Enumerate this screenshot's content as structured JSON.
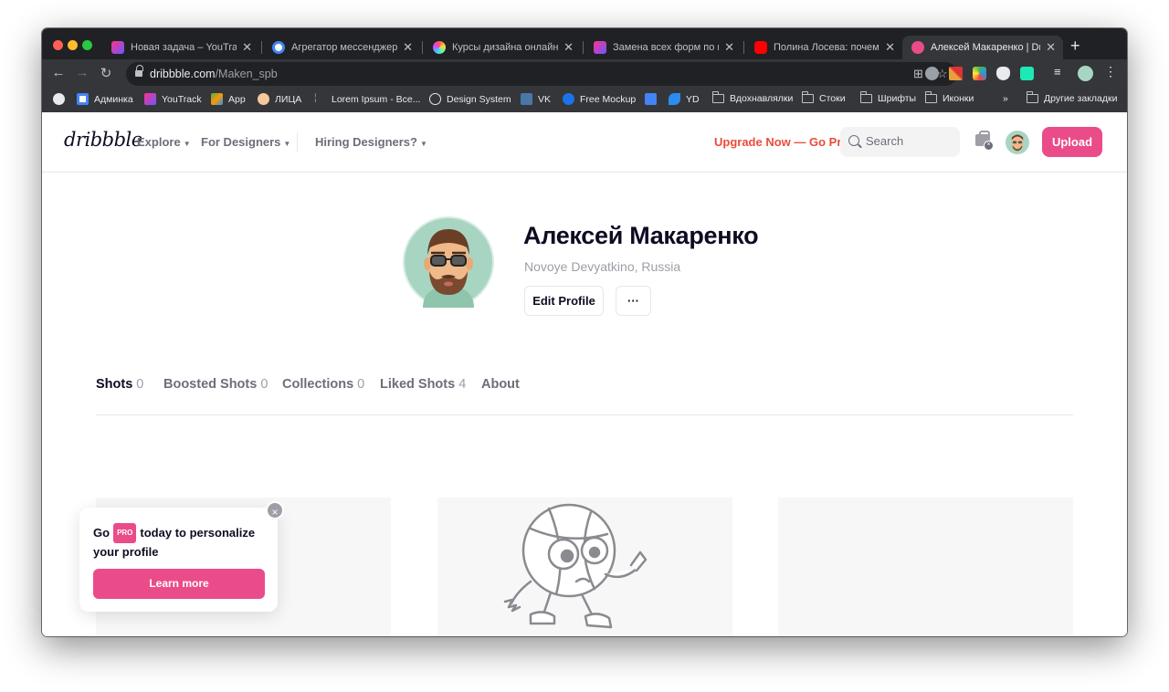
{
  "browser": {
    "tabs": [
      {
        "title": "Новая задача – YouTrack",
        "favicon_color": "#8a5cf6"
      },
      {
        "title": "Агрегатор мессенджеров",
        "favicon_color": "#4285f4"
      },
      {
        "title": "Курсы дизайна онлайн - П",
        "favicon_color": "#e040fb"
      },
      {
        "title": "Замена всех форм по нов",
        "favicon_color": "#8a5cf6"
      },
      {
        "title": "Полина Лосева: почему м",
        "favicon_color": "#ff0000"
      },
      {
        "title": "Алексей Макаренко | Dribb",
        "favicon_color": "#ea4c89"
      }
    ],
    "url_host": "dribbble.com",
    "url_path": "/Maken_spb",
    "bookmarks": [
      {
        "label": "Админка",
        "icon": "globe-icon"
      },
      {
        "label": "YouTrack",
        "icon": "youtrack-icon"
      },
      {
        "label": "App",
        "icon": "cube-icon"
      },
      {
        "label": "ЛИЦА",
        "icon": "face-icon"
      },
      {
        "label": "Lorem Ipsum - Все...",
        "icon": "text-icon"
      },
      {
        "label": "Design System",
        "icon": "loop-icon"
      },
      {
        "label": "VK",
        "icon": "vk-icon"
      },
      {
        "label": "Free Mockup",
        "icon": "c-icon"
      },
      {
        "label": "",
        "icon": "chart-icon"
      },
      {
        "label": "YD",
        "icon": "yd-icon"
      },
      {
        "label": "Вдохнавлялки",
        "icon": "folder-icon"
      },
      {
        "label": "Стоки",
        "icon": "folder-icon"
      },
      {
        "label": "Шрифты",
        "icon": "folder-icon"
      },
      {
        "label": "Иконки",
        "icon": "folder-icon"
      },
      {
        "label": "»",
        "icon": ""
      },
      {
        "label": "Другие закладки",
        "icon": "folder-icon"
      }
    ]
  },
  "site": {
    "logo": "dribbble",
    "nav": {
      "explore": "Explore",
      "designers": "For Designers",
      "hiring": "Hiring Designers?"
    },
    "upgrade": "Upgrade Now — Go Pro",
    "search_placeholder": "Search",
    "upload": "Upload"
  },
  "profile": {
    "name": "Алексей Макаренко",
    "location": "Novoye Devyatkino, Russia",
    "edit": "Edit Profile",
    "more": "···",
    "tabs": [
      {
        "label": "Shots",
        "count": "0"
      },
      {
        "label": "Boosted Shots",
        "count": "0"
      },
      {
        "label": "Collections",
        "count": "0"
      },
      {
        "label": "Liked Shots",
        "count": "4"
      },
      {
        "label": "About",
        "count": ""
      }
    ]
  },
  "promo": {
    "go": "Go",
    "badge": "PRO",
    "text": "today to personalize your profile",
    "button": "Learn more",
    "close": "×"
  },
  "colors": {
    "brand_pink": "#ea4c89",
    "upgrade_red": "#ea4c3c",
    "dark": "#0d0c22"
  }
}
